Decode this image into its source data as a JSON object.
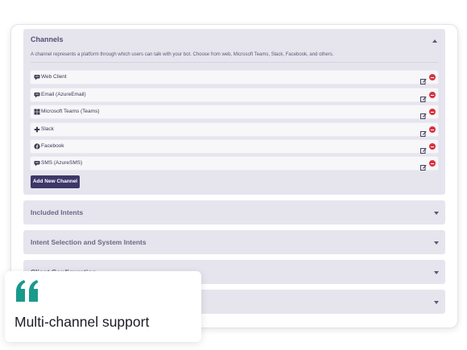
{
  "channels_panel": {
    "title": "Channels",
    "description": "A channel represents a platform through which users can talk with your bot. Choose from web, Microsoft Teams, Slack, Facebook, and others.",
    "channels": [
      {
        "label": "Web Client",
        "icon": "chat-icon"
      },
      {
        "label": "Email (AzureEmail)",
        "icon": "chat-icon"
      },
      {
        "label": "Microsoft Teams (Teams)",
        "icon": "windows-icon"
      },
      {
        "label": "Slack",
        "icon": "slack-icon"
      },
      {
        "label": "Facebook",
        "icon": "facebook-icon"
      },
      {
        "label": "SMS (AzureSMS)",
        "icon": "chat-icon"
      }
    ],
    "add_button_label": "Add New Channel"
  },
  "collapsed_panels": [
    {
      "title": "Included Intents"
    },
    {
      "title": "Intent Selection and System Intents"
    },
    {
      "title": "Client Configuration"
    },
    {
      "title": ""
    }
  ],
  "callout": {
    "text": "Multi-channel support",
    "quote_color": "#1a9a8b"
  },
  "colors": {
    "panel_bg": "#e6e5ee",
    "button_bg": "#3c3768",
    "remove_red": "#d9323f"
  }
}
